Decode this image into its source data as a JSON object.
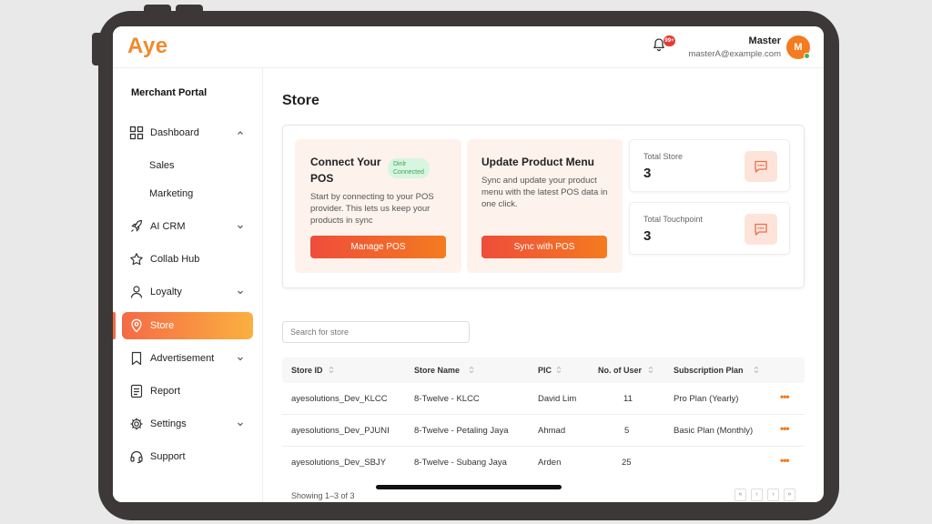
{
  "brand": {
    "logo": "Aye",
    "accent": "#f47b20"
  },
  "header": {
    "notification_badge": "99+",
    "user_name": "Master",
    "user_email": "masterA@example.com",
    "avatar_initial": "M"
  },
  "sidebar": {
    "portal_title": "Merchant Portal",
    "items": [
      {
        "label": "Dashboard",
        "icon": "grid-icon",
        "expandable": true,
        "expanded": true
      },
      {
        "label": "AI CRM",
        "icon": "rocket-icon",
        "expandable": true
      },
      {
        "label": "Collab Hub",
        "icon": "star-icon",
        "expandable": false
      },
      {
        "label": "Loyalty",
        "icon": "user-icon",
        "expandable": true
      },
      {
        "label": "Store",
        "icon": "location-pin-icon",
        "expandable": false,
        "active": true
      },
      {
        "label": "Advertisement",
        "icon": "bookmark-icon",
        "expandable": true
      },
      {
        "label": "Report",
        "icon": "document-icon",
        "expandable": false
      },
      {
        "label": "Settings",
        "icon": "gear-icon",
        "expandable": true
      },
      {
        "label": "Support",
        "icon": "headset-icon",
        "expandable": false
      }
    ],
    "dashboard_sub": [
      "Sales",
      "Marketing"
    ]
  },
  "main": {
    "title": "Store",
    "connect_card": {
      "title_line1": "Connect Your",
      "title_line2": "POS",
      "status_line1": "Dinlr",
      "status_line2": "Connected",
      "description": "Start by connecting to your POS provider. This lets us keep your products in sync",
      "button": "Manage POS"
    },
    "update_card": {
      "title": "Update Product Menu",
      "description": "Sync and update your product menu with the latest POS data in one click.",
      "button": "Sync with POS"
    },
    "stats": [
      {
        "label": "Total Store",
        "value": "3",
        "icon": "chat-icon"
      },
      {
        "label": "Total Touchpoint",
        "value": "3",
        "icon": "chat-icon"
      }
    ],
    "search_placeholder": "Search for store",
    "table": {
      "columns": [
        "Store ID",
        "Store Name",
        "PIC",
        "No. of User",
        "Subscription Plan"
      ],
      "rows": [
        {
          "store_id": "ayesolutions_Dev_KLCC",
          "store_name": "8-Twelve - KLCC",
          "pic": "David Lim",
          "users": "11",
          "plan": "Pro Plan (Yearly)"
        },
        {
          "store_id": "ayesolutions_Dev_PJUNI",
          "store_name": "8-Twelve - Petaling Jaya",
          "pic": "Ahmad",
          "users": "5",
          "plan": "Basic Plan (Monthly)"
        },
        {
          "store_id": "ayesolutions_Dev_SBJY",
          "store_name": "8-Twelve - Subang Jaya",
          "pic": "Arden",
          "users": "25",
          "plan": ""
        }
      ],
      "row_action": "•••",
      "showing": "Showing 1–3 of 3",
      "pager": [
        "«",
        "‹",
        "›",
        "»"
      ]
    }
  }
}
